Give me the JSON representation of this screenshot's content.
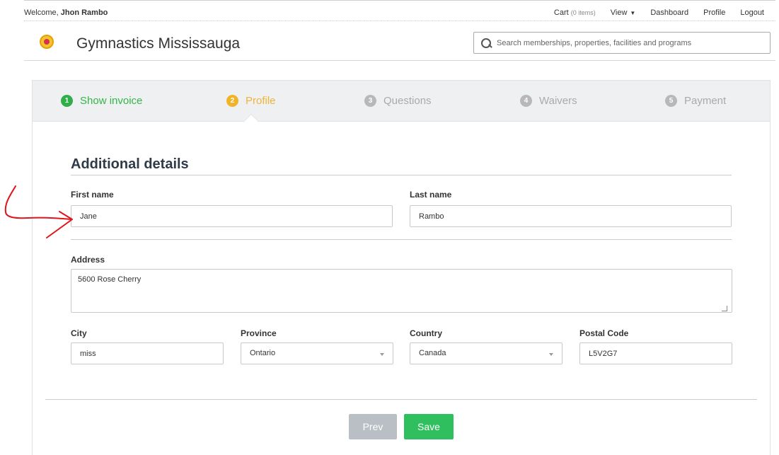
{
  "topbar": {
    "welcome_prefix": "Welcome, ",
    "user_name": "Jhon Rambo",
    "cart_label": "Cart",
    "cart_count": "(0 items)",
    "view_label": "View",
    "dashboard_label": "Dashboard",
    "profile_label": "Profile",
    "logout_label": "Logout"
  },
  "header": {
    "brand": "Gymnastics Mississauga",
    "search_placeholder": "Search memberships, properties, facilities and programs"
  },
  "steps": [
    {
      "num": "1",
      "label": "Show invoice",
      "state": "done"
    },
    {
      "num": "2",
      "label": "Profile",
      "state": "active"
    },
    {
      "num": "3",
      "label": "Questions",
      "state": "pending"
    },
    {
      "num": "4",
      "label": "Waivers",
      "state": "pending"
    },
    {
      "num": "5",
      "label": "Payment",
      "state": "pending"
    }
  ],
  "form": {
    "section_title": "Additional details",
    "first_name_label": "First name",
    "first_name_value": "Jane",
    "last_name_label": "Last name",
    "last_name_value": "Rambo",
    "address_label": "Address",
    "address_value": "5600 Rose Cherry",
    "city_label": "City",
    "city_value": "miss",
    "province_label": "Province",
    "province_value": "Ontario",
    "country_label": "Country",
    "country_value": "Canada",
    "postal_label": "Postal Code",
    "postal_value": "L5V2G7"
  },
  "actions": {
    "prev_label": "Prev",
    "save_label": "Save"
  },
  "colors": {
    "done": "#2fae4a",
    "active": "#f0b428",
    "save_button": "#2fbf5e",
    "prev_button": "#b9bfc5",
    "annotation": "#e0141b"
  },
  "icons": {
    "search": "search-icon",
    "logo": "gymnastics-logo",
    "view_caret": "caret-down-icon",
    "select_arrow": "chevron-down-icon",
    "resize": "resize-handle-icon",
    "annotation": "hand-drawn-arrow"
  }
}
